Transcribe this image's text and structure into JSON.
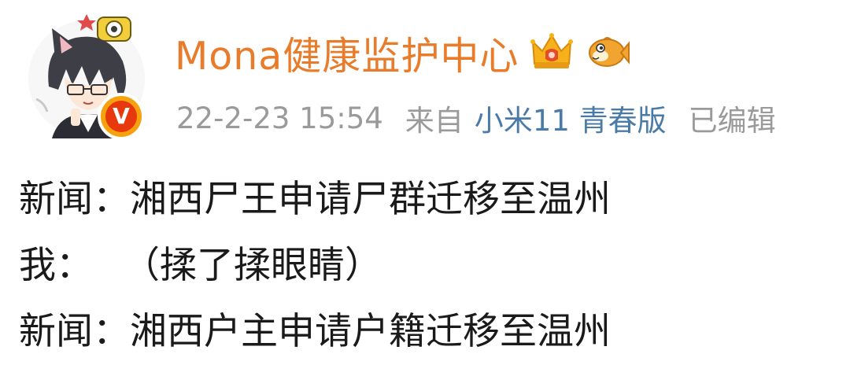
{
  "post": {
    "author": {
      "name": "Mona健康监护中心",
      "avatar_icon": "anime-character-avatar",
      "verified_badge": "V",
      "badges": [
        "crown-icon",
        "fish-icon"
      ],
      "name_color": "#e87c2a"
    },
    "meta": {
      "time": "22-2-23 15:54",
      "source_prefix": "来自",
      "device": "小米11 青春版",
      "edited": "已编辑",
      "device_color": "#4a7ba8"
    },
    "lines": [
      {
        "speaker": "新闻：",
        "text": "湘西尸王申请尸群迁移至温州"
      },
      {
        "speaker": "我：",
        "text": "（揉了揉眼睛）"
      },
      {
        "speaker": "新闻：",
        "text": "湘西户主申请户籍迁移至温州"
      }
    ]
  }
}
